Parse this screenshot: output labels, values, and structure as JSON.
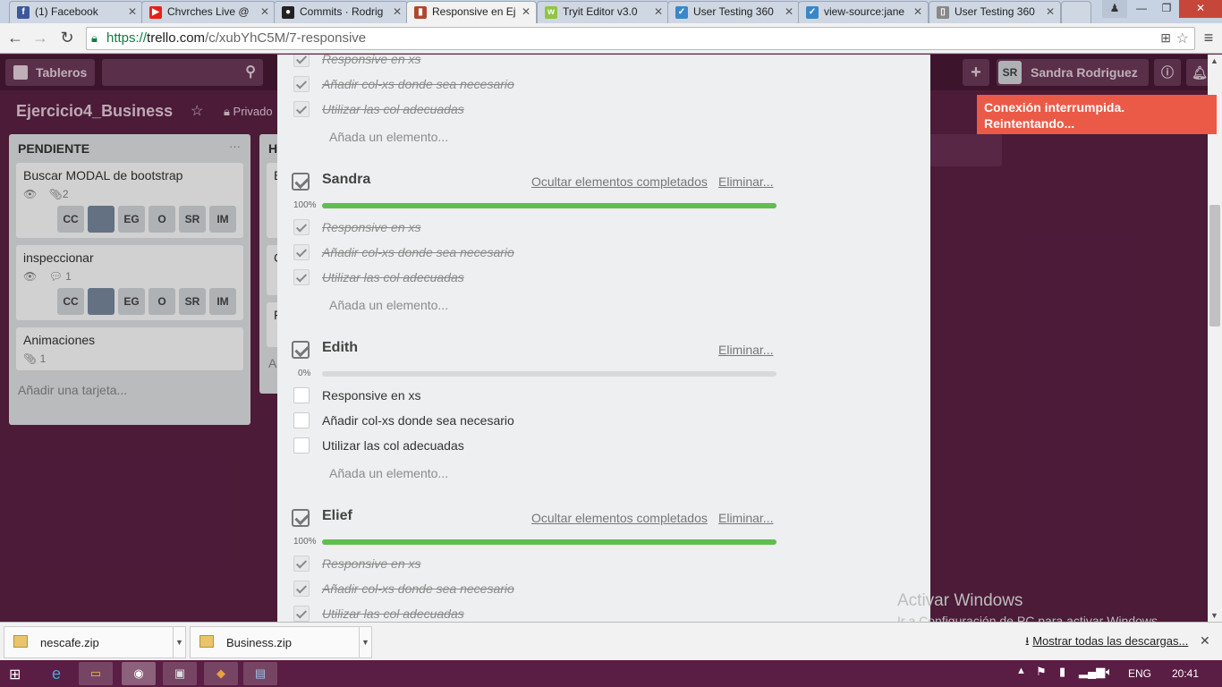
{
  "browser": {
    "tabs": [
      {
        "title": "(1) Facebook",
        "icon": "facebook-icon",
        "color": "#3b5998",
        "glyph": "f"
      },
      {
        "title": "Chvrches Live @",
        "icon": "youtube-icon",
        "color": "#e62117",
        "glyph": "▶"
      },
      {
        "title": "Commits · Rodrig",
        "icon": "github-icon",
        "color": "#222222",
        "glyph": "●"
      },
      {
        "title": "Responsive en Ej",
        "icon": "trello-icon",
        "color": "#b04632",
        "glyph": "▮"
      },
      {
        "title": "Tryit Editor v3.0",
        "icon": "w3schools-icon",
        "color": "#8ec641",
        "glyph": "w"
      },
      {
        "title": "User Testing 360",
        "icon": "checkbox-icon",
        "color": "#3a87c8",
        "glyph": "✓"
      },
      {
        "title": "view-source:jane",
        "icon": "checkbox-icon",
        "color": "#3a87c8",
        "glyph": "✓"
      },
      {
        "title": "User Testing 360",
        "icon": "page-icon",
        "color": "#888888",
        "glyph": "▯"
      }
    ],
    "url": {
      "scheme": "https://",
      "host": "trello.com",
      "path": "/c/xubYhC5M/7-responsive"
    }
  },
  "trello": {
    "header": {
      "boards_label": "Tableros",
      "user_initials": "SR",
      "user_name": "Sandra Rodriguez"
    },
    "board": {
      "title": "Ejercicio4_Business",
      "visibility": "Privado"
    },
    "lists": [
      {
        "title": "PENDIENTE",
        "cards": [
          {
            "title": "Buscar MODAL de bootstrap",
            "attachments": "2",
            "members": [
              "CC",
              "",
              "EG",
              "O",
              "SR",
              "IM"
            ]
          },
          {
            "title": "inspeccionar",
            "comments": "1",
            "members": [
              "CC",
              "",
              "EG",
              "O",
              "SR",
              "IM"
            ]
          },
          {
            "title": "Animaciones",
            "attachments": "1"
          }
        ],
        "add_card": "Añadir una tarjeta..."
      }
    ],
    "list2_title_initial": "H",
    "list2_snippets": [
      "E",
      "C",
      "F"
    ],
    "list2_add_initial": "A",
    "alert": {
      "line1": "Conexión interrumpida.",
      "line2": "Reintentando..."
    }
  },
  "modal": {
    "top_items": [
      "Responsive en xs",
      "Añadir col-xs donde sea necesario",
      "Utilizar las col adecuadas"
    ],
    "add_item": "Añada un elemento...",
    "hide_completed": "Ocultar elementos completados",
    "delete": "Eliminar...",
    "checklists": [
      {
        "title": "Sandra",
        "percent": "100%",
        "progress": 1.0,
        "items": [
          "Responsive en xs",
          "Añadir col-xs donde sea necesario",
          "Utilizar las col adecuadas"
        ],
        "done": true
      },
      {
        "title": "Edith",
        "percent": "0%",
        "progress": 0.0,
        "items": [
          "Responsive en xs",
          "Añadir col-xs donde sea necesario",
          "Utilizar las col adecuadas"
        ],
        "done": false
      },
      {
        "title": "Elief",
        "percent": "100%",
        "progress": 1.0,
        "items": [
          "Responsive en xs",
          "Añadir col-xs donde sea necesario",
          "Utilizar las col adecuadas"
        ],
        "done": true
      }
    ]
  },
  "windows": {
    "watermark_title": "Activar Windows",
    "watermark_sub": "Ir a Configuración de PC para activar Windows.",
    "downloads": [
      {
        "name": "nescafe.zip"
      },
      {
        "name": "Business.zip"
      }
    ],
    "show_all_downloads": "Mostrar todas las descargas...",
    "language": "ENG",
    "time": "20:41"
  },
  "colors": {
    "board_bg": "#5c2145",
    "progress_green": "#61bd4f",
    "alert_red": "#eb5a46"
  }
}
